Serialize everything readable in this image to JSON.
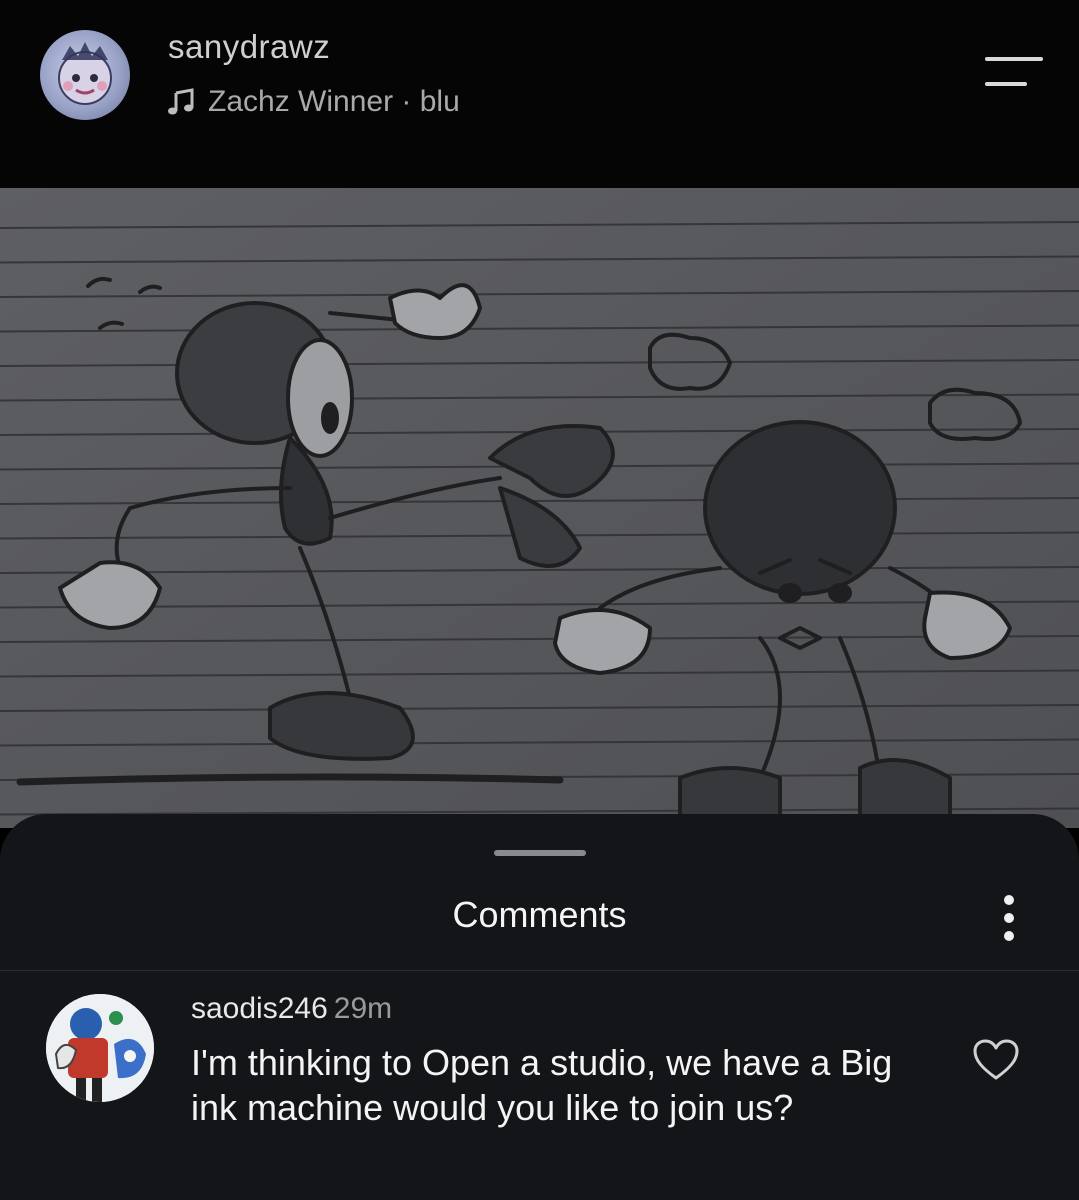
{
  "header": {
    "username": "sanydrawz",
    "audio": "Zachz Winner · blu",
    "avatar_icon": "profile-avatar",
    "music_icon": "music-note-icon",
    "menu_icon": "menu-icon"
  },
  "post": {
    "image_icon": "sketch-image"
  },
  "comments_sheet": {
    "title": "Comments",
    "more_icon": "more-vertical-icon",
    "comments": [
      {
        "username": "saodis246",
        "time": "29m",
        "text": "I'm thinking to Open a studio, we have a Big ink machine would you like to join us?",
        "liked": false
      }
    ]
  },
  "colors": {
    "background": "#000000",
    "sheet": "#141518",
    "text_primary": "#f4f4f4",
    "text_secondary": "#9a9a9a"
  }
}
